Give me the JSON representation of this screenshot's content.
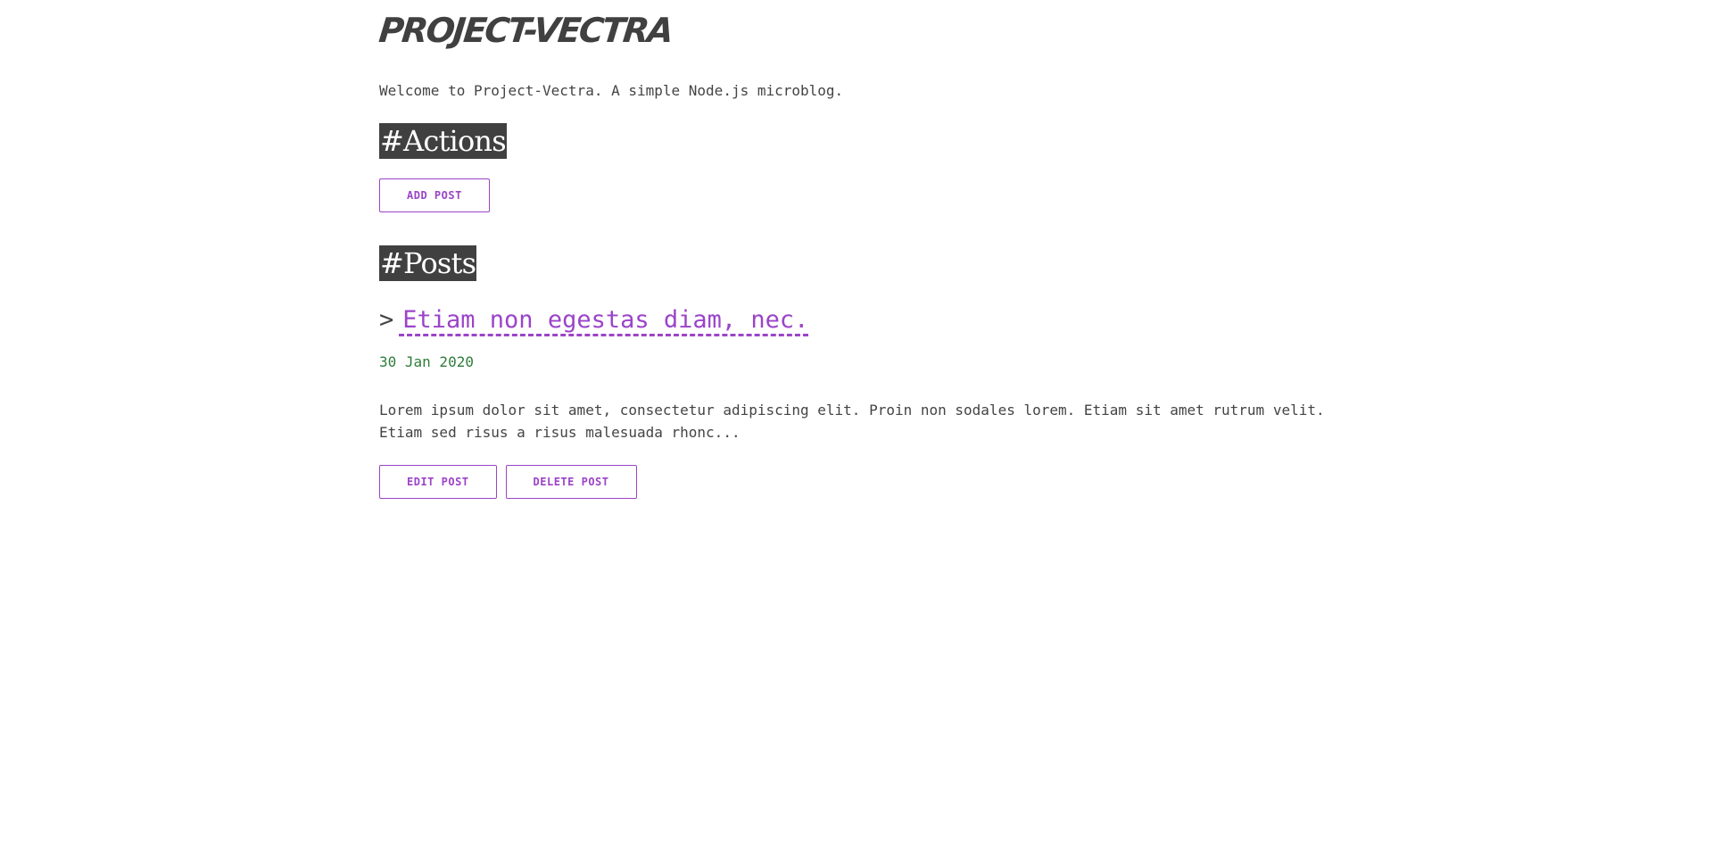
{
  "site": {
    "title": "PROJECT-VECTRA",
    "welcome": "Welcome to Project-Vectra. A simple Node.js microblog."
  },
  "actions": {
    "heading": "#Actions",
    "add_post_label": "ADD POST"
  },
  "posts": {
    "heading": "#Posts",
    "items": [
      {
        "prefix": ">",
        "title": "Etiam non egestas diam, nec.",
        "date": "30 Jan 2020",
        "excerpt_line1": "Lorem ipsum dolor sit amet, consectetur adipiscing elit. Proin non sodales lorem. Etiam sit amet rutrum velit.",
        "excerpt_line2": "Etiam sed risus a risus malesuada rhonc...",
        "edit_label": "EDIT POST",
        "delete_label": "DELETE POST"
      }
    ]
  },
  "colors": {
    "accent": "#9b44c8",
    "text": "#444444",
    "heading_bg": "#404040",
    "date": "#2e7d3a"
  }
}
